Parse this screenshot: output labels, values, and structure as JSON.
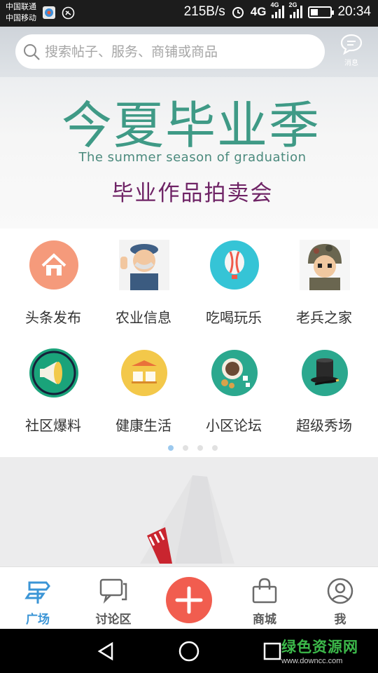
{
  "status_bar": {
    "carrier_1": "中国联通",
    "carrier_2": "中国移动",
    "net_speed": "215B/s",
    "signal_1_type": "4G",
    "signal_2_type": "2G",
    "time": "20:34",
    "battery_level": 0.35,
    "icons": [
      "app-notification-icon",
      "location-icon",
      "alarm-icon",
      "4g-icon",
      "signal-icon",
      "battery-icon"
    ]
  },
  "search": {
    "placeholder": "搜索帖子、服务、商铺或商品"
  },
  "messages": {
    "label": "消息"
  },
  "banner": {
    "title": "今夏毕业季",
    "subtitle": "The summer season of graduation",
    "event": "毕业作品拍卖会"
  },
  "categories": [
    {
      "label": "头条发布",
      "icon": "house-icon",
      "color": "#f59a7b"
    },
    {
      "label": "农业信息",
      "icon": "farmer-icon",
      "color": "#7d6a5a"
    },
    {
      "label": "吃喝玩乐",
      "icon": "hot-air-balloon-icon",
      "color": "#35c4d6"
    },
    {
      "label": "老兵之家",
      "icon": "soldier-icon",
      "color": "#5d5a4a"
    },
    {
      "label": "社区爆料",
      "icon": "megaphone-icon",
      "color": "#1aa37a"
    },
    {
      "label": "健康生活",
      "icon": "spa-icon",
      "color": "#f3c84a"
    },
    {
      "label": "小区论坛",
      "icon": "coffee-icon",
      "color": "#2ba88e"
    },
    {
      "label": "超级秀场",
      "icon": "magic-hat-icon",
      "color": "#2ba88e"
    }
  ],
  "pager": {
    "pages": 4,
    "current": 1
  },
  "tabs": [
    {
      "label": "广场",
      "icon": "signpost-icon",
      "active": true
    },
    {
      "label": "讨论区",
      "icon": "chat-bubbles-icon",
      "active": false
    },
    {
      "label": "",
      "icon": "plus-icon",
      "active": false
    },
    {
      "label": "商城",
      "icon": "shopping-bag-icon",
      "active": false
    },
    {
      "label": "我",
      "icon": "user-icon",
      "active": false
    }
  ],
  "colors": {
    "accent": "#3b95d6",
    "add_button": "#f15d4f",
    "banner_green": "#3f9a86",
    "banner_purple": "#6f2466"
  },
  "watermark": {
    "main": "绿色资源网",
    "sub": "www.downcc.com"
  }
}
